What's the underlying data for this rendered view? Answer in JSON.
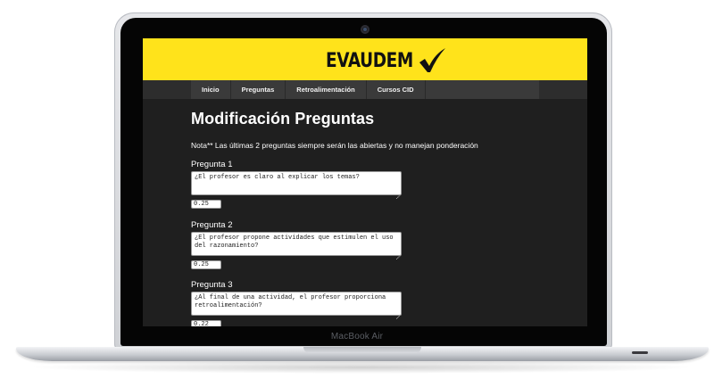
{
  "device": {
    "label": "MacBook Air"
  },
  "site": {
    "logo_text": "EVAUDEM",
    "logo_icon": "checkmark-icon",
    "banner_color": "#ffe31b",
    "nav_background": "#3a3a3a"
  },
  "nav": {
    "items": [
      {
        "label": "Inicio"
      },
      {
        "label": "Preguntas"
      },
      {
        "label": "Retroalimentación"
      },
      {
        "label": "Cursos CID"
      }
    ]
  },
  "page": {
    "title": "Modificación Preguntas",
    "note": "Nota** Las últimas 2 preguntas siempre serán las abiertas y no manejan ponderación"
  },
  "questions": [
    {
      "label": "Pregunta 1",
      "text": "¿El profesor es claro al explicar los temas?",
      "weight": "0.25"
    },
    {
      "label": "Pregunta 2",
      "text": "¿El profesor propone actividades que estimulen el uso del razonamiento?",
      "weight": "0.25"
    },
    {
      "label": "Pregunta 3",
      "text": "¿Al final de una actividad, el profesor proporciona retroalimentación?",
      "weight": "0.22"
    }
  ]
}
